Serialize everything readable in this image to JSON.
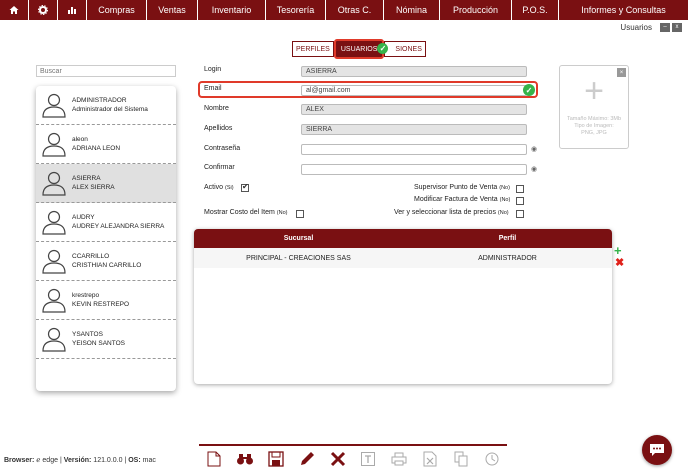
{
  "nav": {
    "menu": [
      "Compras",
      "Ventas",
      "Inventario",
      "Tesorería",
      "Otras C.",
      "Nómina",
      "Producción",
      "P.O.S.",
      "Informes y Consultas"
    ]
  },
  "window": {
    "title": "Usuarios",
    "minimize": "–",
    "close": "x"
  },
  "tabs": [
    "PERFILES",
    "USUARIOS",
    "SIONES"
  ],
  "search": {
    "placeholder": "Buscar"
  },
  "users": [
    {
      "login": "ADMINISTRADOR",
      "name": "Administrador del Sistema"
    },
    {
      "login": "aleon",
      "name": "ADRIANA LEON"
    },
    {
      "login": "ASIERRA",
      "name": "ALEX SIERRA"
    },
    {
      "login": "AUDRY",
      "name": "AUDREY ALEJANDRA SIERRA"
    },
    {
      "login": "CCARRILLO",
      "name": "CRISTHIAN CARRILLO"
    },
    {
      "login": "krestrepo",
      "name": "KEVIN RESTREPO"
    },
    {
      "login": "YSANTOS",
      "name": "YEISON SANTOS"
    }
  ],
  "form": {
    "login_label": "Login",
    "login_value": "ASIERRA",
    "email_label": "Email",
    "email_value": "al@gmail.com",
    "nombre_label": "Nombre",
    "nombre_value": "ALEX",
    "apellidos_label": "Apellidos",
    "apellidos_value": "SIERRA",
    "password_label": "Contraseña",
    "confirm_label": "Confirmar"
  },
  "photo": {
    "caption": [
      "Tamaño Máximo: 3Mb",
      "Tipo de Imagen:",
      "PNG, JPG"
    ]
  },
  "options": {
    "activo": "Activo",
    "activo_flag": "(Si)",
    "costo": "Mostrar Costo del Item",
    "costo_flag": "(No)",
    "supervisor": "Supervisor Punto de Venta",
    "supervisor_flag": "(No)",
    "factura": "Modificar Factura de Venta",
    "factura_flag": "(No)",
    "precios": "Ver y seleccionar lista de precios",
    "precios_flag": "(No)"
  },
  "grid": {
    "headers": [
      "Sucursal",
      "Perfil"
    ],
    "rows": [
      [
        "PRINCIPAL - CREACIONES SAS",
        "ADMINISTRADOR"
      ]
    ]
  },
  "footer": {
    "browser_label": "Browser:",
    "browser_value": "edge",
    "version_label": "Versión:",
    "version_value": "121.0.0.0",
    "os_label": "OS:",
    "os_value": "mac",
    "sep": "|"
  },
  "colors": {
    "brand": "#7a1012",
    "accent_red": "#e03a2a",
    "green": "#35b34a"
  }
}
